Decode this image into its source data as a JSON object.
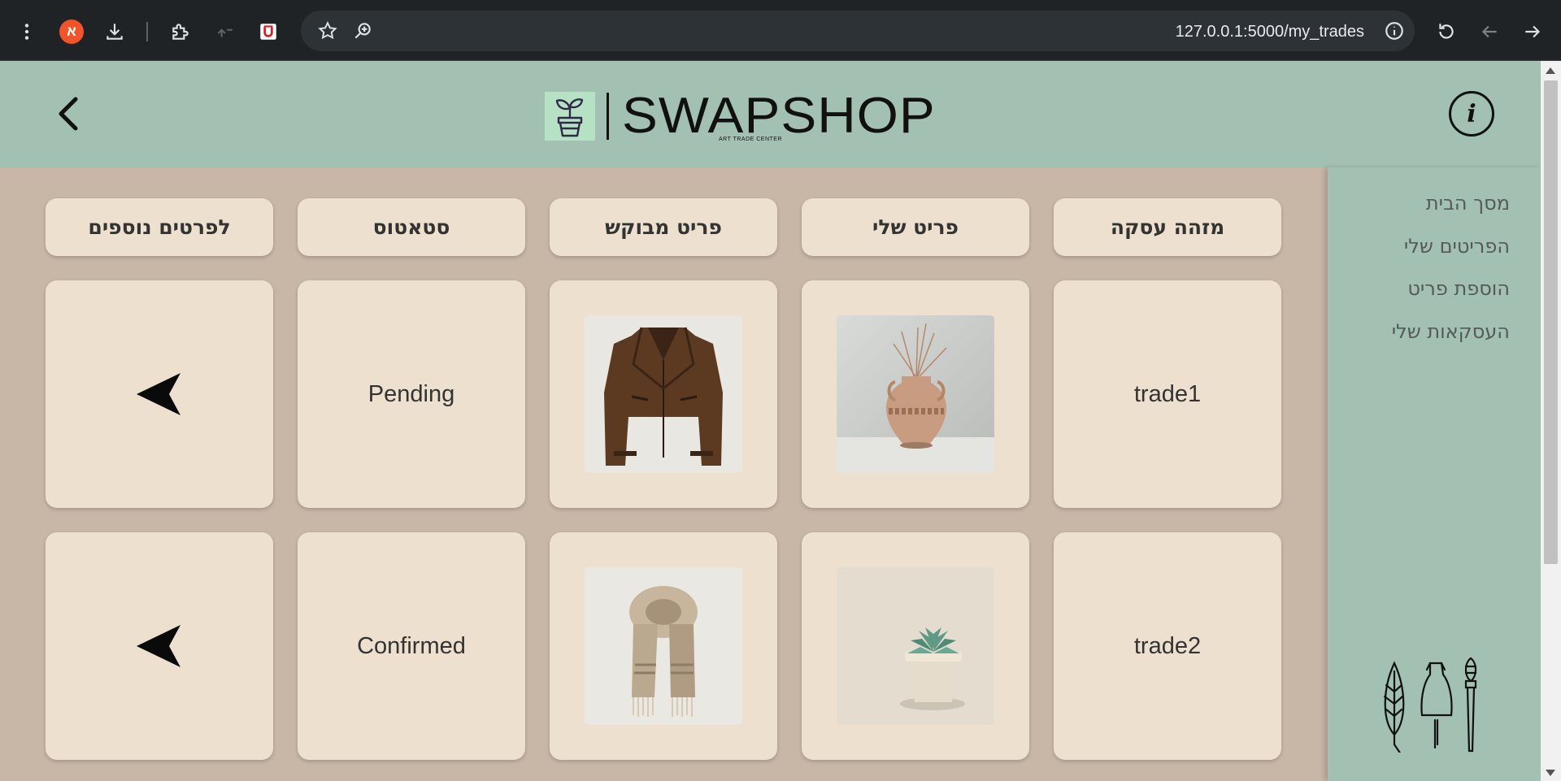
{
  "browser": {
    "profile_initial": "א",
    "url": "127.0.0.1:5000/my_trades"
  },
  "header": {
    "logo_text": "SWAPSHOP",
    "logo_subtitle": "ART TRADE CENTER",
    "info_label": "i"
  },
  "sidebar": {
    "items": [
      {
        "label": "מסך הבית"
      },
      {
        "label": "הפריטים שלי"
      },
      {
        "label": "הוספת פריט"
      },
      {
        "label": "העסקאות שלי"
      }
    ]
  },
  "table": {
    "headers": {
      "trade_id": "מזהה עסקה",
      "my_item": "פריט שלי",
      "requested_item": "פריט מבוקש",
      "status": "סטאטוס",
      "details": "לפרטים נוספים"
    },
    "rows": [
      {
        "trade_id": "trade1",
        "my_item_image": "clay-vase-with-dried-grass",
        "requested_item_image": "brown-leather-jacket",
        "status": "Pending"
      },
      {
        "trade_id": "trade2",
        "my_item_image": "succulent-in-pot",
        "requested_item_image": "knitted-scarf",
        "status": "Confirmed"
      }
    ]
  },
  "colors": {
    "header_bg": "#a3c1b3",
    "content_bg": "#c8b6a6",
    "card_bg": "#ede0cf",
    "logo_accent": "#b7e1c4"
  }
}
